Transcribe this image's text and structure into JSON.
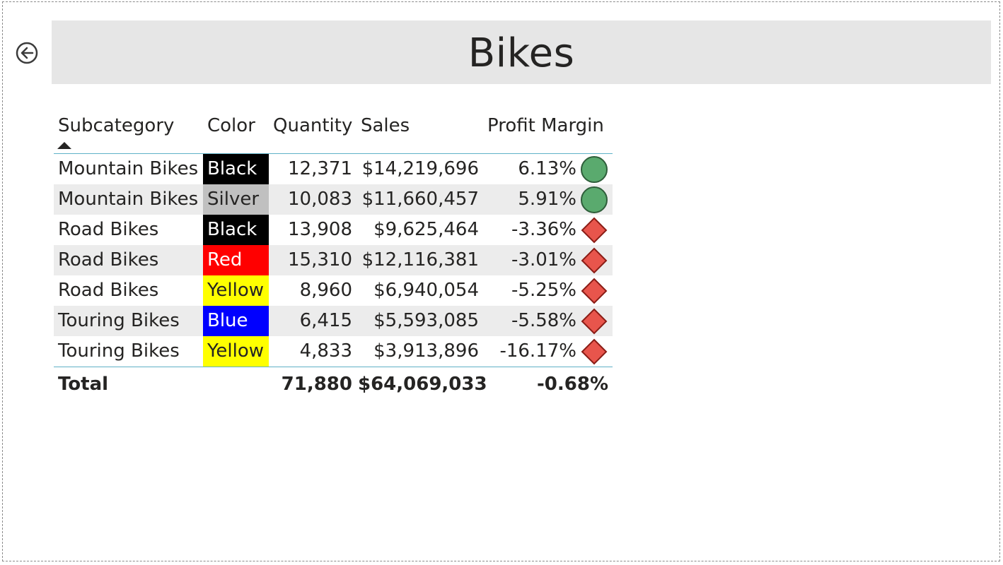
{
  "header": {
    "title": "Bikes"
  },
  "back_button": {
    "icon": "back-arrow-icon"
  },
  "table": {
    "columns": [
      "Subcategory",
      "Color",
      "Quantity",
      "Sales",
      "Profit Margin"
    ],
    "sort": {
      "column": "Subcategory",
      "direction": "ascending"
    },
    "rows": [
      {
        "subcategory": "Mountain Bikes",
        "color": "Black",
        "color_bg": "#000000",
        "color_fg": "#ffffff",
        "quantity": "12,371",
        "sales": "$14,219,696",
        "profit_margin": "6.13%",
        "indicator": "green-circle-icon"
      },
      {
        "subcategory": "Mountain Bikes",
        "color": "Silver",
        "color_bg": "#c0c0c0",
        "color_fg": "#252423",
        "quantity": "10,083",
        "sales": "$11,660,457",
        "profit_margin": "5.91%",
        "indicator": "green-circle-icon"
      },
      {
        "subcategory": "Road Bikes",
        "color": "Black",
        "color_bg": "#000000",
        "color_fg": "#ffffff",
        "quantity": "13,908",
        "sales": "$9,625,464",
        "profit_margin": "-3.36%",
        "indicator": "red-diamond-icon"
      },
      {
        "subcategory": "Road Bikes",
        "color": "Red",
        "color_bg": "#ff0000",
        "color_fg": "#ffffff",
        "quantity": "15,310",
        "sales": "$12,116,381",
        "profit_margin": "-3.01%",
        "indicator": "red-diamond-icon"
      },
      {
        "subcategory": "Road Bikes",
        "color": "Yellow",
        "color_bg": "#ffff00",
        "color_fg": "#252423",
        "quantity": "8,960",
        "sales": "$6,940,054",
        "profit_margin": "-5.25%",
        "indicator": "red-diamond-icon"
      },
      {
        "subcategory": "Touring Bikes",
        "color": "Blue",
        "color_bg": "#0000ff",
        "color_fg": "#ffffff",
        "quantity": "6,415",
        "sales": "$5,593,085",
        "profit_margin": "-5.58%",
        "indicator": "red-diamond-icon"
      },
      {
        "subcategory": "Touring Bikes",
        "color": "Yellow",
        "color_bg": "#ffff00",
        "color_fg": "#252423",
        "quantity": "4,833",
        "sales": "$3,913,896",
        "profit_margin": "-16.17%",
        "indicator": "red-diamond-icon"
      }
    ],
    "totals": {
      "label": "Total",
      "quantity": "71,880",
      "sales": "$64,069,033",
      "profit_margin": "-0.68%"
    }
  },
  "colors": {
    "title_bar": "#e6e6e6",
    "row_alt": "#ececec",
    "divider": "#5fb1c7",
    "positive_indicator": "#5aaa6e",
    "negative_indicator": "#e8554c"
  }
}
